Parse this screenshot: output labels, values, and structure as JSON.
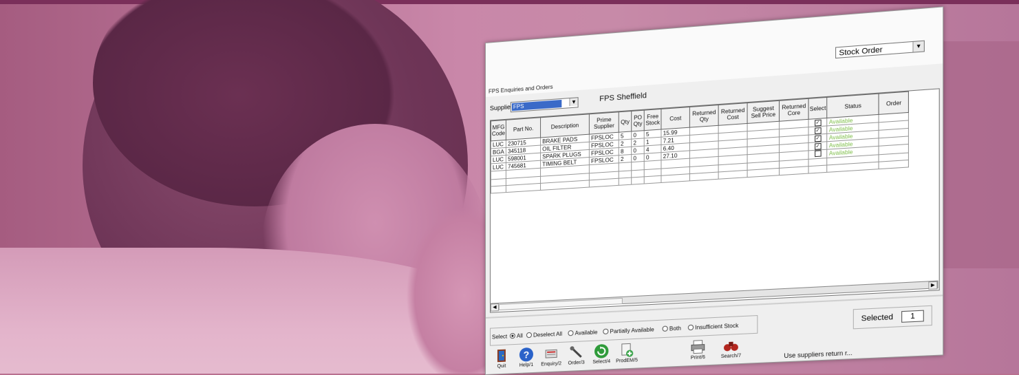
{
  "window": {
    "title": "FPS Enquiries and Orders",
    "order_type": "Stock Order"
  },
  "supplier": {
    "label": "Supplier",
    "code": "FPS",
    "name": "FPS Sheffield"
  },
  "grid": {
    "columns": [
      "MFG Code",
      "Part No.",
      "Description",
      "Prime Supplier",
      "Qty",
      "PO Qty",
      "Free Stock",
      "Cost",
      "Returned Qty",
      "Returned Cost",
      "Suggest Sell Price",
      "Returned Core",
      "Select",
      "Status",
      "Order"
    ],
    "rows": [
      {
        "mfg": "LUC",
        "part": "230715",
        "desc": "BRAKE PADS",
        "supplier": "FPSLOC",
        "qty": "5",
        "po": "0",
        "free": "5",
        "cost": "15.99",
        "selected": true,
        "status": "Available"
      },
      {
        "mfg": "BGA",
        "part": "345118",
        "desc": "OIL FILTER",
        "supplier": "FPSLOC",
        "qty": "2",
        "po": "2",
        "free": "1",
        "cost": "7.21",
        "selected": true,
        "status": "Available"
      },
      {
        "mfg": "LUC",
        "part": "598001",
        "desc": "SPARK PLUGS",
        "supplier": "FPSLOC",
        "qty": "8",
        "po": "0",
        "free": "4",
        "cost": "6.40",
        "selected": true,
        "status": "Available"
      },
      {
        "mfg": "LUC",
        "part": "745681",
        "desc": "TIMING BELT",
        "supplier": "FPSLOC",
        "qty": "2",
        "po": "0",
        "free": "0",
        "cost": "27.10",
        "selected": true,
        "status": "Available"
      },
      {
        "mfg": "",
        "part": "",
        "desc": "",
        "supplier": "",
        "qty": "",
        "po": "",
        "free": "",
        "cost": "",
        "selected": false,
        "status": "Available"
      }
    ]
  },
  "select_options": {
    "label": "Select",
    "options": [
      "All",
      "Deselect All",
      "Available",
      "Partially Available",
      "Both",
      "Insufficient Stock"
    ],
    "selected_index": 0
  },
  "selected_count": {
    "label": "Selected",
    "value": "1"
  },
  "toolbar": {
    "buttons": [
      "Quit",
      "Help/1",
      "Enquiry/2",
      "Order/3",
      "Select/4",
      "ProdEM/5",
      "Print/6",
      "Search/7"
    ]
  },
  "hint": "Use suppliers return r...",
  "colors": {
    "banner": "#7a2f5a",
    "available": "#7fbf4a",
    "selection": "#3a6ac8"
  }
}
